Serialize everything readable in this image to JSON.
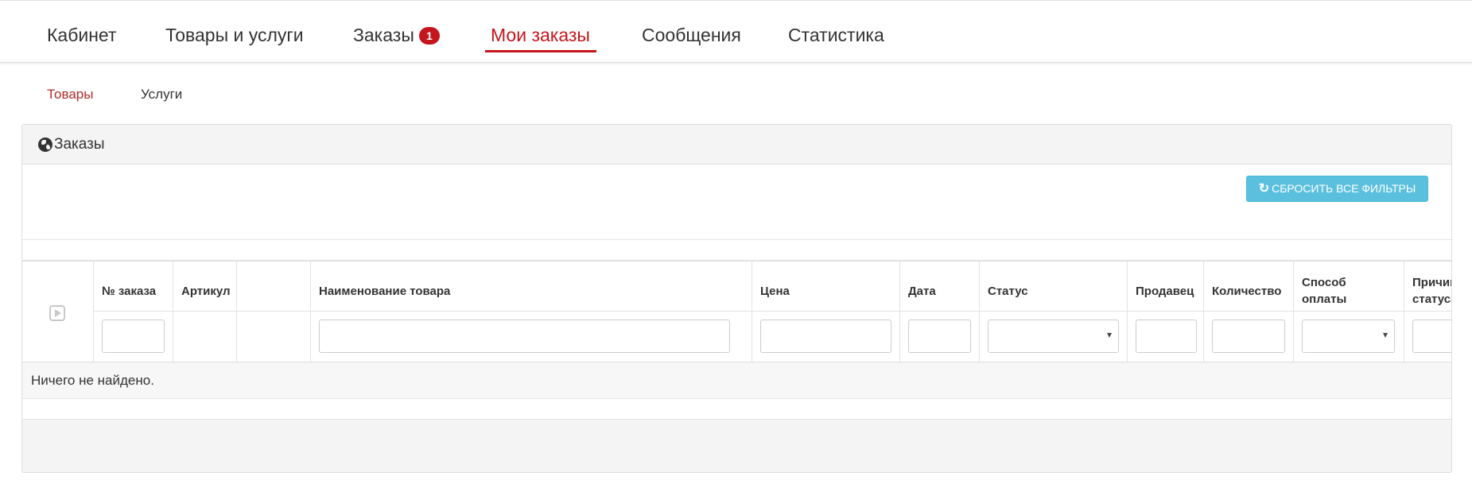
{
  "main_nav": {
    "items": [
      {
        "label": "Кабинет"
      },
      {
        "label": "Товары и услуги"
      },
      {
        "label": "Заказы",
        "badge": "1"
      },
      {
        "label": "Мои заказы",
        "active": true
      },
      {
        "label": "Сообщения"
      },
      {
        "label": "Статистика"
      }
    ]
  },
  "sub_nav": {
    "items": [
      {
        "label": "Товары",
        "active": true
      },
      {
        "label": "Услуги"
      }
    ]
  },
  "panel": {
    "title": "Заказы",
    "title_icon": "globe-icon",
    "reset_button": {
      "label": "СБРОСИТЬ ВСЕ ФИЛЬТРЫ",
      "icon": "refresh-icon"
    }
  },
  "table": {
    "columns": [
      {
        "label": "№ заказа",
        "filter": "text"
      },
      {
        "label": "Артикул",
        "filter": "none"
      },
      {
        "label": "",
        "filter": "none"
      },
      {
        "label": "Наименование товара",
        "filter": "text"
      },
      {
        "label": "Цена",
        "filter": "text"
      },
      {
        "label": "Дата",
        "filter": "text"
      },
      {
        "label": "Статус",
        "filter": "select"
      },
      {
        "label": "Продавец",
        "filter": "text"
      },
      {
        "label": "Количество",
        "filter": "text"
      },
      {
        "label": "Способ оплаты",
        "filter": "select"
      },
      {
        "label": "Причина статуса",
        "filter": "select"
      }
    ],
    "empty_text": "Ничего не найдено."
  },
  "colors": {
    "accent": "#c4161c",
    "info_button": "#5bc0de",
    "panel_bg": "#f4f4f4"
  }
}
